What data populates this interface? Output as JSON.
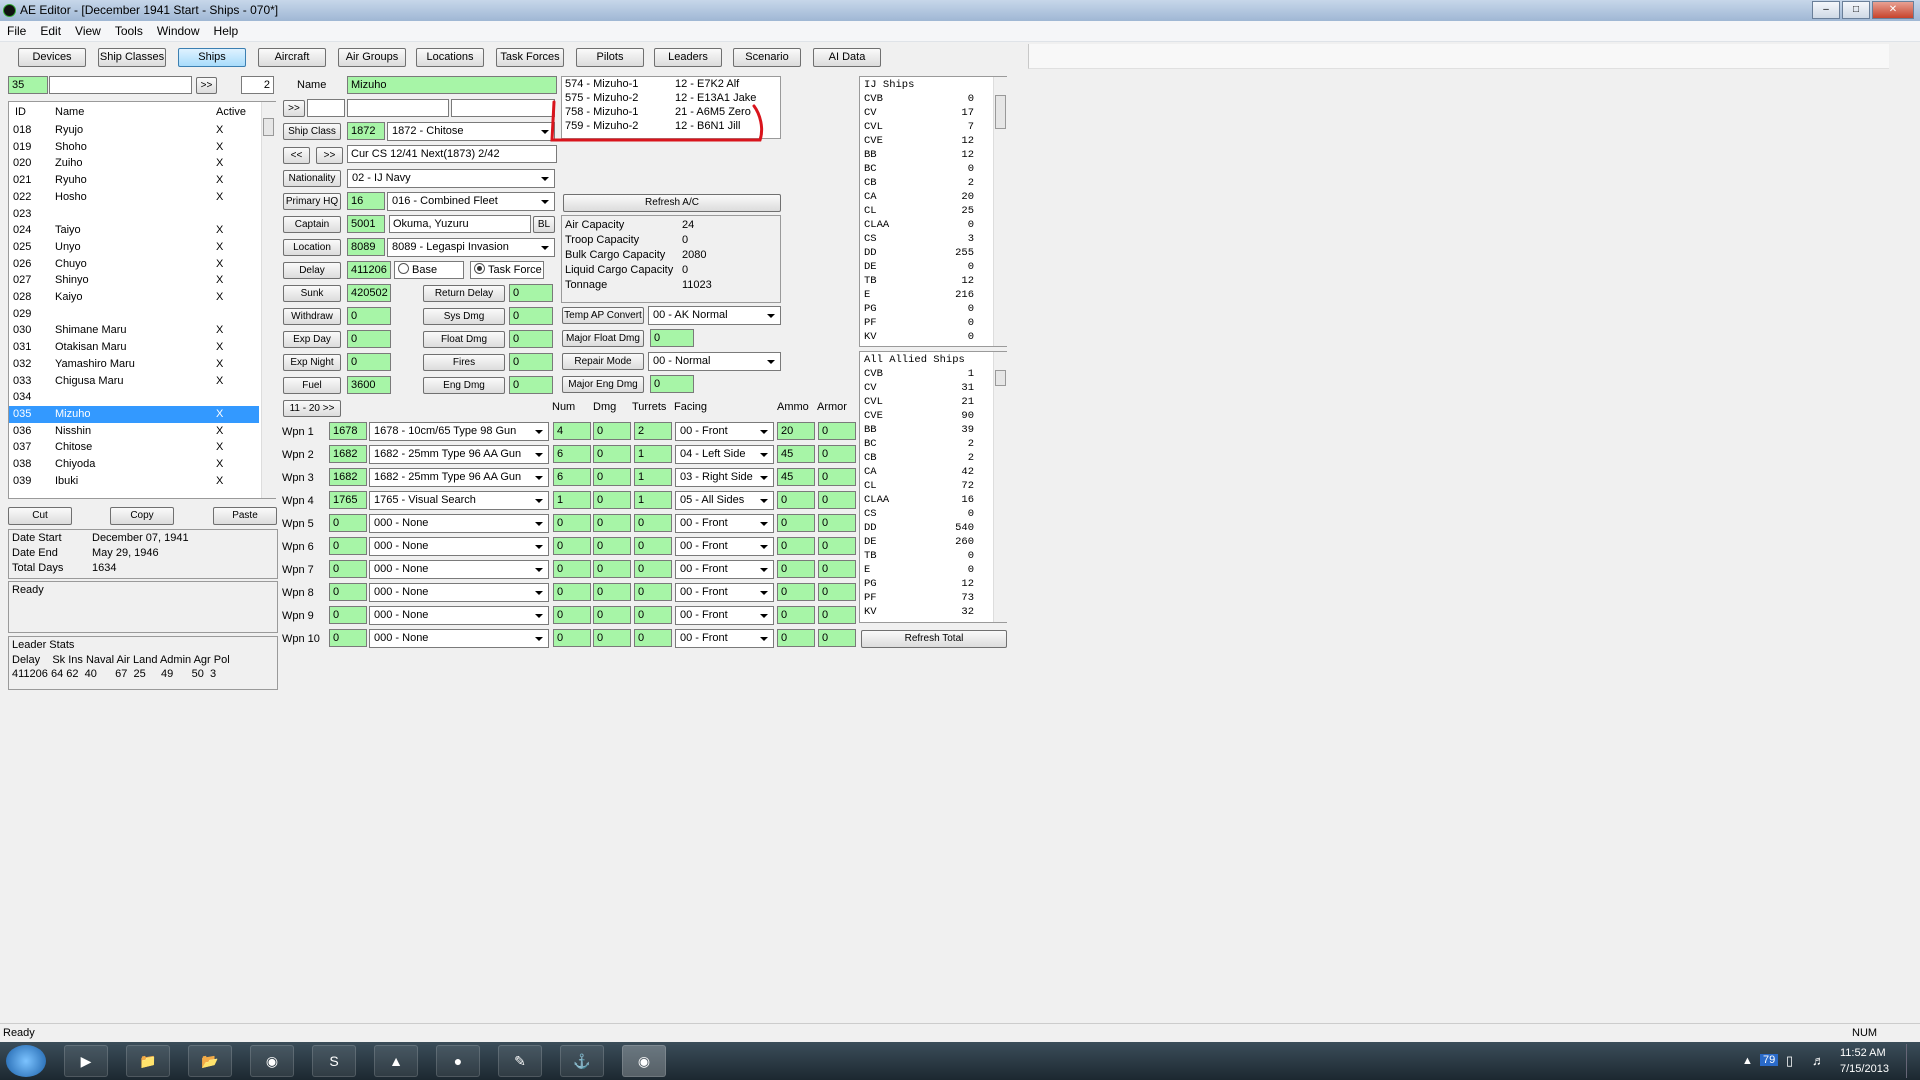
{
  "window": {
    "title": "AE Editor - [December 1941 Start - Ships - 070*]"
  },
  "menu": [
    "File",
    "Edit",
    "View",
    "Tools",
    "Window",
    "Help"
  ],
  "tabs": [
    "Devices",
    "Ship Classes",
    "Ships",
    "Aircraft",
    "Air Groups",
    "Locations",
    "Task Forces",
    "Pilots",
    "Leaders",
    "Scenario",
    "AI Data"
  ],
  "selected_tab": "Ships",
  "nav": {
    "id_value": "35",
    "search_value": "",
    "go_label": ">>",
    "count": "2"
  },
  "list": {
    "headers": {
      "id": "ID",
      "name": "Name",
      "active": "Active"
    },
    "rows": [
      {
        "id": "018",
        "name": "Ryujo",
        "active": "X"
      },
      {
        "id": "019",
        "name": "Shoho",
        "active": "X"
      },
      {
        "id": "020",
        "name": "Zuiho",
        "active": "X"
      },
      {
        "id": "021",
        "name": "Ryuho",
        "active": "X"
      },
      {
        "id": "022",
        "name": "Hosho",
        "active": "X"
      },
      {
        "id": "023",
        "name": "",
        "active": ""
      },
      {
        "id": "024",
        "name": "Taiyo",
        "active": "X"
      },
      {
        "id": "025",
        "name": "Unyo",
        "active": "X"
      },
      {
        "id": "026",
        "name": "Chuyo",
        "active": "X"
      },
      {
        "id": "027",
        "name": "Shinyo",
        "active": "X"
      },
      {
        "id": "028",
        "name": "Kaiyo",
        "active": "X"
      },
      {
        "id": "029",
        "name": "",
        "active": ""
      },
      {
        "id": "030",
        "name": "Shimane Maru",
        "active": "X"
      },
      {
        "id": "031",
        "name": "Otakisan Maru",
        "active": "X"
      },
      {
        "id": "032",
        "name": "Yamashiro Maru",
        "active": "X"
      },
      {
        "id": "033",
        "name": "Chigusa Maru",
        "active": "X"
      },
      {
        "id": "034",
        "name": "",
        "active": ""
      },
      {
        "id": "035",
        "name": "Mizuho",
        "active": "X"
      },
      {
        "id": "036",
        "name": "Nisshin",
        "active": "X"
      },
      {
        "id": "037",
        "name": "Chitose",
        "active": "X"
      },
      {
        "id": "038",
        "name": "Chiyoda",
        "active": "X"
      },
      {
        "id": "039",
        "name": "Ibuki",
        "active": "X"
      }
    ],
    "selected_id": "035"
  },
  "clipboard": {
    "cut": "Cut",
    "copy": "Copy",
    "paste": "Paste"
  },
  "dates": {
    "start_label": "Date Start",
    "start_value": "December 07, 1941",
    "end_label": "Date End",
    "end_value": "May 29, 1946",
    "days_label": "Total Days",
    "days_value": "1634"
  },
  "status_box": "Ready",
  "leader_stats": {
    "title": "Leader Stats",
    "header": "Delay    Sk Ins Naval Air Land Admin Agr Pol",
    "values": "411206 64 62  40      67  25     49      50  3"
  },
  "ship": {
    "name_label": "Name",
    "name": "Mizuho",
    "nav_next": ">>",
    "ship_class_label": "Ship Class",
    "ship_class_id": "1872",
    "ship_class": "1872 - Chitose",
    "prev": "<<",
    "next": ">>",
    "class_info": "Cur CS 12/41 Next(1873) 2/42",
    "nationality_label": "Nationality",
    "nationality": "02 - IJ Navy",
    "hq_label": "Primary HQ",
    "hq_id": "16",
    "hq": "016 - Combined Fleet",
    "captain_label": "Captain",
    "captain_id": "5001",
    "captain": "Okuma, Yuzuru",
    "bl": "BL",
    "location_label": "Location",
    "location_id": "8089",
    "location": "8089 - Legaspi Invasion",
    "delay_label": "Delay",
    "delay": "411206",
    "base_label": "Base",
    "tf_label": "Task Force",
    "sunk_label": "Sunk",
    "sunk": "420502",
    "withdraw_label": "Withdraw",
    "withdraw": "0",
    "expday_label": "Exp Day",
    "expday": "0",
    "expnight_label": "Exp Night",
    "expnight": "0",
    "fuel_label": "Fuel",
    "fuel": "3600",
    "return_delay_label": "Return Delay",
    "return_delay": "0",
    "sys_dmg_label": "Sys Dmg",
    "sys_dmg": "0",
    "float_dmg_label": "Float Dmg",
    "float_dmg": "0",
    "fires_label": "Fires",
    "fires": "0",
    "eng_dmg_label": "Eng Dmg",
    "eng_dmg": "0",
    "weapons_page": "11 - 20 >>"
  },
  "aircraft": [
    {
      "id": "574 - Mizuho-1",
      "ac": "12 - E7K2 Alf"
    },
    {
      "id": "575 - Mizuho-2",
      "ac": "12 - E13A1 Jake"
    },
    {
      "id": "758 - Mizuho-1",
      "ac": "21 - A6M5 Zero"
    },
    {
      "id": "759 - Mizuho-2",
      "ac": "12 - B6N1 Jill"
    }
  ],
  "refresh_ac": "Refresh A/C",
  "capacity": [
    {
      "label": "Air Capacity",
      "value": "24"
    },
    {
      "label": "Troop Capacity",
      "value": "0"
    },
    {
      "label": "Bulk Cargo Capacity",
      "value": "2080"
    },
    {
      "label": "Liquid Cargo Capacity",
      "value": "0"
    },
    {
      "label": "Tonnage",
      "value": "11023"
    }
  ],
  "misc": {
    "temp_ap_label": "Temp AP Convert",
    "temp_ap": "00 - AK Normal",
    "major_float_label": "Major Float Dmg",
    "major_float": "0",
    "repair_label": "Repair Mode",
    "repair": "00 - Normal",
    "major_eng_label": "Major Eng Dmg",
    "major_eng": "0"
  },
  "weapon_headers": {
    "num": "Num",
    "dmg": "Dmg",
    "turrets": "Turrets",
    "facing": "Facing",
    "ammo": "Ammo",
    "armor": "Armor"
  },
  "weapons": [
    {
      "label": "Wpn 1",
      "id": "1678",
      "name": "1678 - 10cm/65 Type 98 Gun",
      "num": "4",
      "dmg": "0",
      "turrets": "2",
      "facing": "00 - Front",
      "ammo": "20",
      "armor": "0"
    },
    {
      "label": "Wpn 2",
      "id": "1682",
      "name": "1682 - 25mm Type 96 AA Gun",
      "num": "6",
      "dmg": "0",
      "turrets": "1",
      "facing": "04 - Left Side",
      "ammo": "45",
      "armor": "0"
    },
    {
      "label": "Wpn 3",
      "id": "1682",
      "name": "1682 - 25mm Type 96 AA Gun",
      "num": "6",
      "dmg": "0",
      "turrets": "1",
      "facing": "03 - Right Side",
      "ammo": "45",
      "armor": "0"
    },
    {
      "label": "Wpn 4",
      "id": "1765",
      "name": "1765 - Visual Search",
      "num": "1",
      "dmg": "0",
      "turrets": "1",
      "facing": "05 - All Sides",
      "ammo": "0",
      "armor": "0"
    },
    {
      "label": "Wpn 5",
      "id": "0",
      "name": "000 - None",
      "num": "0",
      "dmg": "0",
      "turrets": "0",
      "facing": "00 - Front",
      "ammo": "0",
      "armor": "0"
    },
    {
      "label": "Wpn 6",
      "id": "0",
      "name": "000 - None",
      "num": "0",
      "dmg": "0",
      "turrets": "0",
      "facing": "00 - Front",
      "ammo": "0",
      "armor": "0"
    },
    {
      "label": "Wpn 7",
      "id": "0",
      "name": "000 - None",
      "num": "0",
      "dmg": "0",
      "turrets": "0",
      "facing": "00 - Front",
      "ammo": "0",
      "armor": "0"
    },
    {
      "label": "Wpn 8",
      "id": "0",
      "name": "000 - None",
      "num": "0",
      "dmg": "0",
      "turrets": "0",
      "facing": "00 - Front",
      "ammo": "0",
      "armor": "0"
    },
    {
      "label": "Wpn 9",
      "id": "0",
      "name": "000 - None",
      "num": "0",
      "dmg": "0",
      "turrets": "0",
      "facing": "00 - Front",
      "ammo": "0",
      "armor": "0"
    },
    {
      "label": "Wpn 10",
      "id": "0",
      "name": "000 - None",
      "num": "0",
      "dmg": "0",
      "turrets": "0",
      "facing": "00 - Front",
      "ammo": "0",
      "armor": "0"
    }
  ],
  "ij_ships": {
    "title": "IJ Ships",
    "rows": [
      [
        "CVB",
        "0"
      ],
      [
        "CV",
        "17"
      ],
      [
        "CVL",
        "7"
      ],
      [
        "CVE",
        "12"
      ],
      [
        "BB",
        "12"
      ],
      [
        "BC",
        "0"
      ],
      [
        "CB",
        "2"
      ],
      [
        "CA",
        "20"
      ],
      [
        "CL",
        "25"
      ],
      [
        "CLAA",
        "0"
      ],
      [
        "CS",
        "3"
      ],
      [
        "DD",
        "255"
      ],
      [
        "DE",
        "0"
      ],
      [
        "TB",
        "12"
      ],
      [
        "E",
        "216"
      ],
      [
        "PG",
        "0"
      ],
      [
        "PF",
        "0"
      ],
      [
        "KV",
        "0"
      ]
    ]
  },
  "allied_ships": {
    "title": "All Allied Ships",
    "rows": [
      [
        "CVB",
        "1"
      ],
      [
        "CV",
        "31"
      ],
      [
        "CVL",
        "21"
      ],
      [
        "CVE",
        "90"
      ],
      [
        "BB",
        "39"
      ],
      [
        "BC",
        "2"
      ],
      [
        "CB",
        "2"
      ],
      [
        "CA",
        "42"
      ],
      [
        "CL",
        "72"
      ],
      [
        "CLAA",
        "16"
      ],
      [
        "CS",
        "0"
      ],
      [
        "DD",
        "540"
      ],
      [
        "DE",
        "260"
      ],
      [
        "TB",
        "0"
      ],
      [
        "E",
        "0"
      ],
      [
        "PG",
        "12"
      ],
      [
        "PF",
        "73"
      ],
      [
        "KV",
        "32"
      ]
    ]
  },
  "refresh_total": "Refresh Total",
  "statusbar": {
    "text": "Ready",
    "num": "NUM"
  },
  "taskbar": {
    "time": "11:52 AM",
    "date": "7/15/2013",
    "badge": "79"
  },
  "annotation_color": "#d9141c"
}
